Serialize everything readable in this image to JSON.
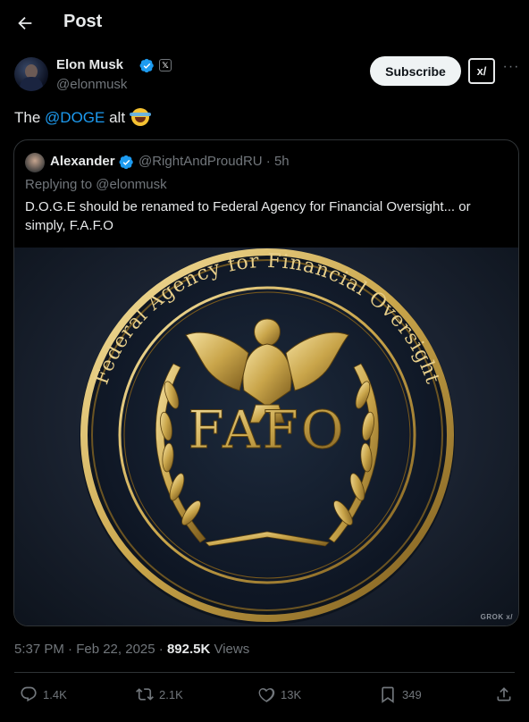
{
  "header": {
    "title": "Post"
  },
  "author": {
    "name": "Elon Musk",
    "handle": "@elonmusk",
    "x_badge": "𝕏"
  },
  "buttons": {
    "subscribe": "Subscribe",
    "grok": "x/",
    "more": "···"
  },
  "tweet": {
    "prefix": "The ",
    "mention": "@DOGE",
    "suffix": " alt"
  },
  "quote": {
    "name": "Alexander",
    "handle_time": "@RightAndProudRU · 5h",
    "replying_to": "Replying to @elonmusk",
    "text": "D.O.G.E should be renamed to Federal Agency for Financial Oversight... or simply, F.A.F.O",
    "image": {
      "ring_text": "Federal Agency for Financial Oversight",
      "center_text": "FAFO",
      "watermark": "GROK"
    }
  },
  "meta": {
    "time_date": "5:37 PM · Feb 22, 2025 · ",
    "views_count": "892.5K",
    "views_label": " Views"
  },
  "actions": {
    "replies": "1.4K",
    "reposts": "2.1K",
    "likes": "13K",
    "bookmarks": "349"
  },
  "colors": {
    "accent": "#1d9bf0",
    "background": "#000000",
    "muted": "#71767b",
    "gold": "#c9a54a"
  },
  "icons": [
    "back-arrow-icon",
    "verified-icon",
    "x-logo-icon",
    "grok-icon",
    "more-icon",
    "reply-icon",
    "repost-icon",
    "like-icon",
    "bookmark-icon",
    "share-icon"
  ]
}
